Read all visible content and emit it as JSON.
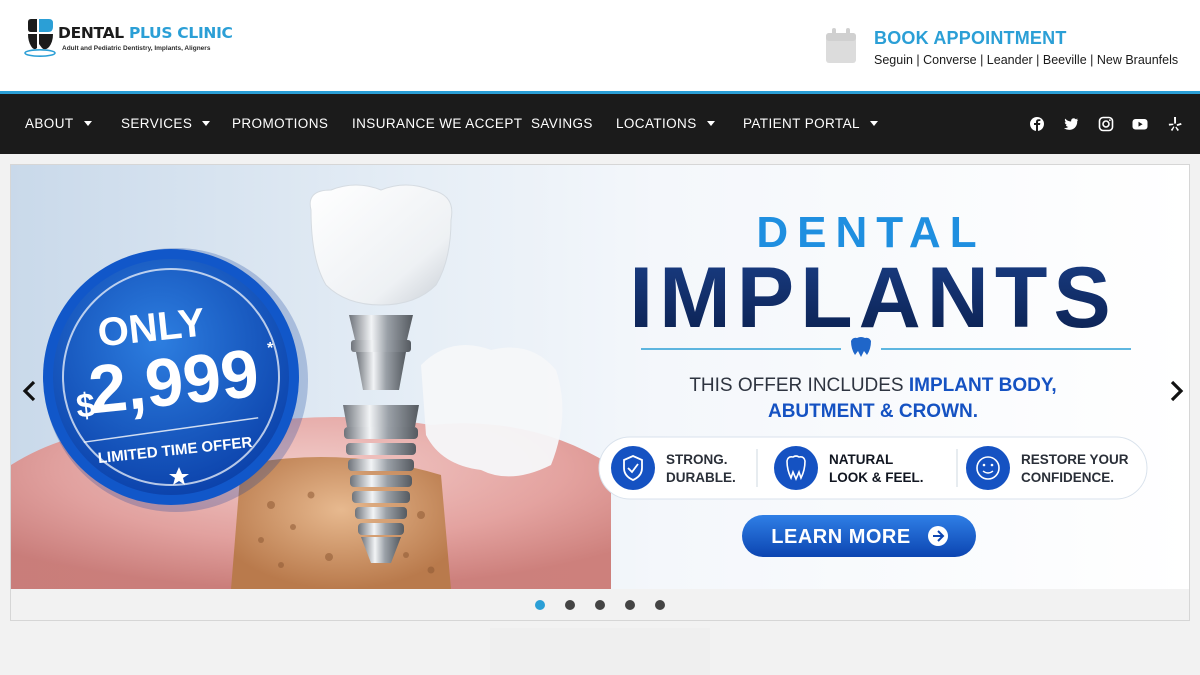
{
  "brand": {
    "name_part1": "DENTAL ",
    "name_part2": "PLUS CLINIC",
    "tagline": "Adult and Pediatric Dentistry, Implants, Aligners",
    "accent": "#2b9fd6",
    "dark": "#1b1b1b"
  },
  "header": {
    "book_label": "BOOK APPOINTMENT",
    "locations": "Seguin | Converse | Leander | Beeville | New Braunfels",
    "icon": "calendar-icon"
  },
  "nav": {
    "items": [
      {
        "label": "ABOUT",
        "dropdown": true
      },
      {
        "label": "SERVICES",
        "dropdown": true
      },
      {
        "label": "PROMOTIONS",
        "dropdown": false
      },
      {
        "label": "INSURANCE WE ACCEPT",
        "dropdown": false
      },
      {
        "label": "SAVINGS",
        "dropdown": false
      },
      {
        "label": "LOCATIONS",
        "dropdown": true
      },
      {
        "label": "PATIENT PORTAL",
        "dropdown": true
      }
    ],
    "social": [
      "facebook-icon",
      "twitter-icon",
      "instagram-icon",
      "youtube-icon",
      "yelp-icon"
    ]
  },
  "slider": {
    "badge_only": "ONLY",
    "badge_dollar": "$",
    "badge_price": "2,999",
    "badge_asterisk": "*",
    "badge_limited": "LIMITED TIME OFFER",
    "headline_small": "DENTAL",
    "headline_large": "IMPLANTS",
    "offer_line1_a": "THIS OFFER INCLUDES ",
    "offer_line1_b": "IMPLANT BODY,",
    "offer_line2": "ABUTMENT & CROWN.",
    "features": [
      {
        "line1": "STRONG.",
        "line2": "DURABLE.",
        "icon": "shield-check-icon"
      },
      {
        "line1": "NATURAL",
        "line2": "LOOK & FEEL.",
        "icon": "tooth-icon"
      },
      {
        "line1": "RESTORE YOUR",
        "line2": "CONFIDENCE.",
        "icon": "smiley-icon"
      }
    ],
    "cta": "LEARN MORE",
    "slide_count": 5,
    "active_slide": 1
  }
}
